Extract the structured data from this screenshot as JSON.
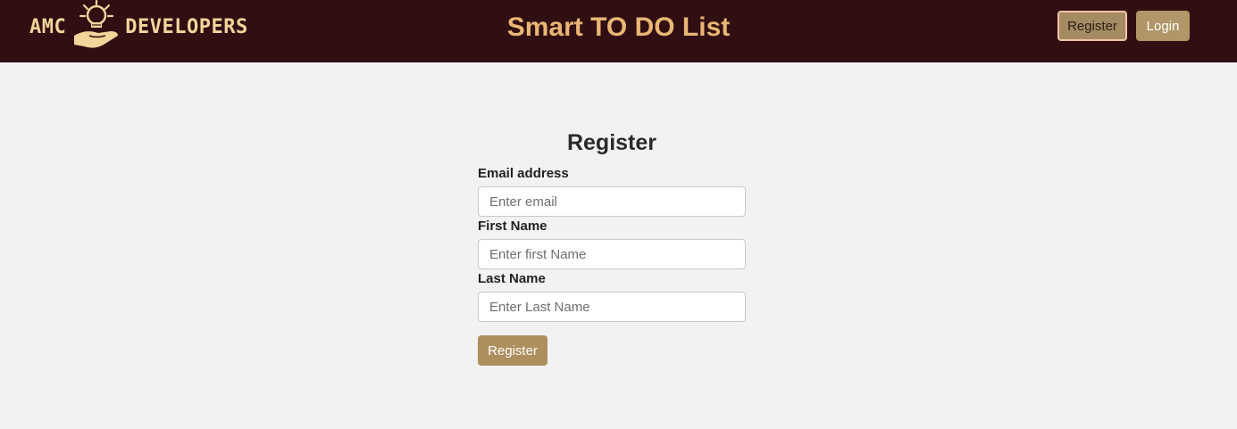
{
  "header": {
    "logo": {
      "left_text": "AMC",
      "right_text": "DEVELOPERS",
      "icon": "lightbulb-hand-icon"
    },
    "title": "Smart TO DO List",
    "register_label": "Register",
    "login_label": "Login"
  },
  "form": {
    "title": "Register",
    "email": {
      "label": "Email address",
      "placeholder": "Enter email"
    },
    "first_name": {
      "label": "First Name",
      "placeholder": "Enter first Name"
    },
    "last_name": {
      "label": "Last Name",
      "placeholder": "Enter Last Name"
    },
    "submit_label": "Register"
  },
  "colors": {
    "header_bg": "#300e12",
    "logo_text": "#f3d59b",
    "title_text": "#e9b673",
    "accent_button": "#ae8f5e",
    "page_bg": "#f2f2f2"
  }
}
